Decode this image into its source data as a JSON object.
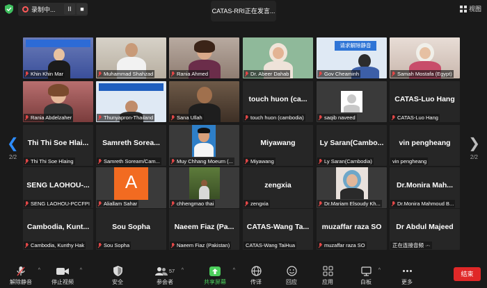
{
  "topbar": {
    "recording_label": "录制中...",
    "pause_symbol": "II",
    "stop_symbol": "■",
    "speaking_text": "CATAS-RRI正在发言...",
    "view_label": "视图",
    "shield_icon": "shield-check-icon",
    "shield_color": "#3fbf5f"
  },
  "pagination": {
    "left": "2/2",
    "right": "2/2",
    "prev_symbol": "❮",
    "next_symbol": "❯"
  },
  "tiles": [
    {
      "name": "Khin Khin Mar",
      "muted": true,
      "video": "blue"
    },
    {
      "name": "Muhammad Shahzad",
      "muted": true,
      "video": "office"
    },
    {
      "name": "Rania Ahmed",
      "muted": true,
      "video": "bed"
    },
    {
      "name": "Dr. Abeer Dahab",
      "muted": true,
      "video": "green"
    },
    {
      "name": "Gov Cheaminh",
      "muted": true,
      "video": "slide",
      "slide_text": "请求解除静音"
    },
    {
      "name": "Samah Mostafa (Egypt)",
      "muted": true,
      "video": "pink"
    },
    {
      "name": "Rania Abdelzaher",
      "muted": true,
      "video": "red"
    },
    {
      "name": "Thunyapron-Thailand",
      "muted": true,
      "video": "slide2"
    },
    {
      "name": "Sana Ullah",
      "muted": true,
      "video": "room"
    },
    {
      "name": "touch huon (cambodia)",
      "muted": true,
      "big": "touch huon (ca..."
    },
    {
      "name": "saqib naveed",
      "muted": true,
      "video": "avatar"
    },
    {
      "name": "CATAS-Luo Hang",
      "muted": true,
      "big": "CATAS-Luo Hang"
    },
    {
      "name": "Thi Thi Soe Hlaing",
      "muted": true,
      "big": "Thi Thi Soe Hlai..."
    },
    {
      "name": "Samreth Soream/Cam...",
      "muted": true,
      "big": "Samreth Sorea..."
    },
    {
      "name": "Muy Chhang Moeurn (...",
      "muted": true,
      "video": "portrait"
    },
    {
      "name": "Miyawang",
      "muted": true,
      "big": "Miyawang"
    },
    {
      "name": "Ly Saran(Cambodia)",
      "muted": true,
      "big": "Ly Saran(Cambo..."
    },
    {
      "name": "vin pengheang",
      "muted": false,
      "big": "vin pengheang"
    },
    {
      "name": "SENG LAOHOU-PCCFPI",
      "muted": true,
      "big": "SENG LAOHOU-..."
    },
    {
      "name": "Aliallam Sahar",
      "muted": true,
      "video": "letter",
      "letter": "A"
    },
    {
      "name": "chhengmao thai",
      "muted": true,
      "video": "forest"
    },
    {
      "name": "zengxia",
      "muted": true,
      "big": "zengxia"
    },
    {
      "name": "Dr.Mariam Elsoudy Kh...",
      "muted": true,
      "video": "woman"
    },
    {
      "name": "Dr.Monira Mahmoud B...",
      "muted": true,
      "big": "Dr.Monira Mah..."
    },
    {
      "name": "Cambodia, Kunthy Hak",
      "muted": true,
      "big": "Cambodia, Kunt..."
    },
    {
      "name": "Sou Sopha",
      "muted": true,
      "big": "Sou Sopha"
    },
    {
      "name": "Naeem Fiaz (Pakistan)",
      "muted": true,
      "big": "Naeem Fiaz (Pa..."
    },
    {
      "name": "CATAS-Wang TaiHua",
      "muted": false,
      "big": "CATAS-Wang Ta..."
    },
    {
      "name": "muzaffar raza SO",
      "muted": true,
      "big": "muzaffar raza SO"
    },
    {
      "name": "正在连接音频 ·-·",
      "muted": false,
      "big": "Dr Abdul Majeed"
    }
  ],
  "toolbar": {
    "unmute": "解除静音",
    "stop_video": "停止视频",
    "security": "安全",
    "participants": "参会者",
    "participant_count": "57",
    "share_screen": "共享屏幕",
    "translate": "传译",
    "reactions": "回应",
    "apps": "应用",
    "whiteboard": "白板",
    "more": "更多",
    "end": "结束",
    "share_color": "#4ccf5c",
    "end_color": "#e02828"
  }
}
